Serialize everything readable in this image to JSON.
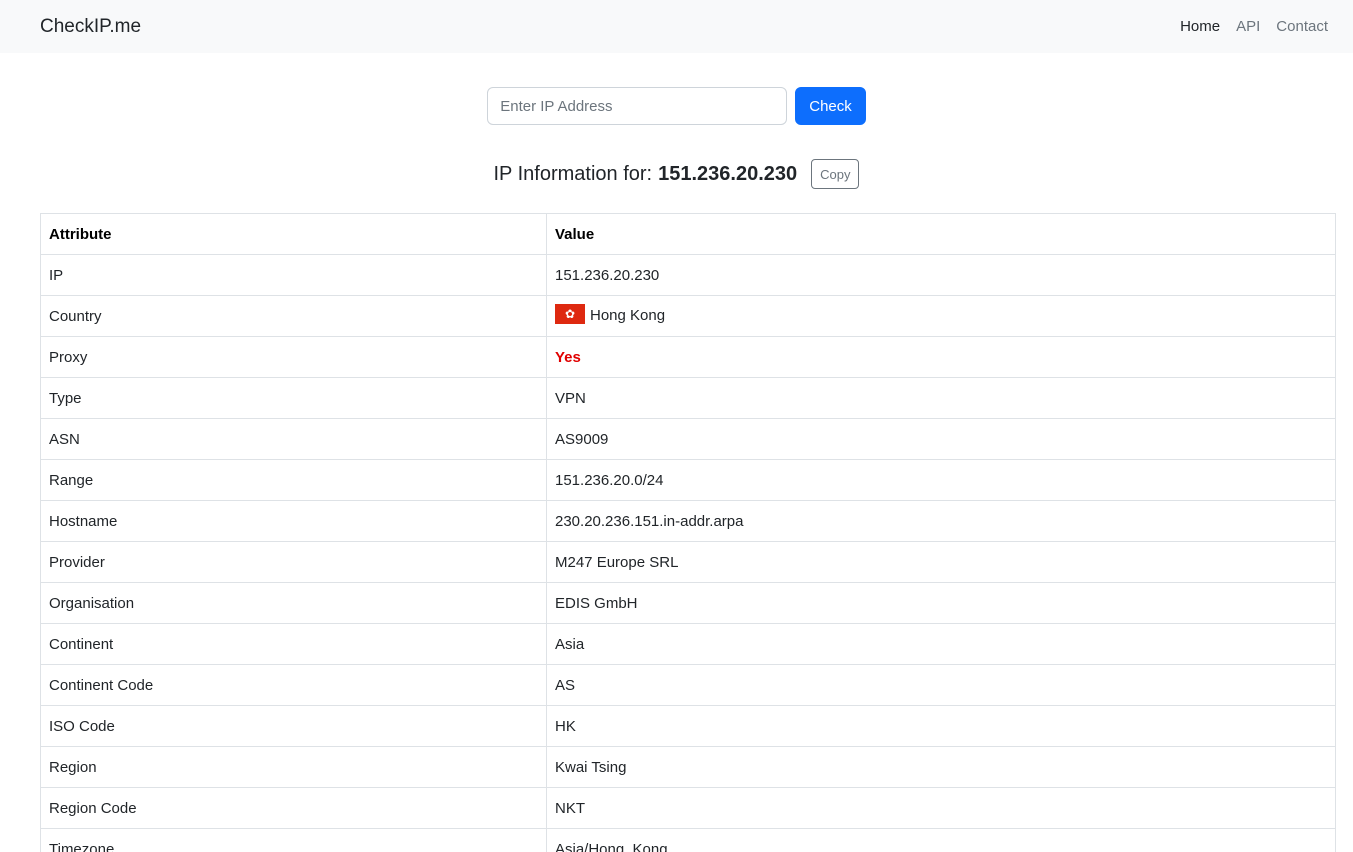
{
  "navbar": {
    "brand": "CheckIP.me",
    "links": [
      "Home",
      "API",
      "Contact"
    ]
  },
  "search": {
    "placeholder": "Enter IP Address",
    "value": "",
    "button_label": "Check"
  },
  "heading": {
    "prefix": "IP Information for:",
    "ip": "151.236.20.230",
    "copy_label": "Copy"
  },
  "table": {
    "headers": [
      "Attribute",
      "Value"
    ],
    "rows": [
      {
        "attribute": "IP",
        "value": "151.236.20.230"
      },
      {
        "attribute": "Country",
        "value": "Hong Kong"
      },
      {
        "attribute": "Proxy",
        "value": "Yes"
      },
      {
        "attribute": "Type",
        "value": "VPN"
      },
      {
        "attribute": "ASN",
        "value": "AS9009"
      },
      {
        "attribute": "Range",
        "value": "151.236.20.0/24"
      },
      {
        "attribute": "Hostname",
        "value": "230.20.236.151.in-addr.arpa"
      },
      {
        "attribute": "Provider",
        "value": "M247 Europe SRL"
      },
      {
        "attribute": "Organisation",
        "value": "EDIS GmbH"
      },
      {
        "attribute": "Continent",
        "value": "Asia"
      },
      {
        "attribute": "Continent Code",
        "value": "AS"
      },
      {
        "attribute": "ISO Code",
        "value": "HK"
      },
      {
        "attribute": "Region",
        "value": "Kwai Tsing"
      },
      {
        "attribute": "Region Code",
        "value": "NKT"
      },
      {
        "attribute": "Timezone",
        "value": "Asia/Hong_Kong"
      }
    ]
  },
  "colors": {
    "primary": "#0d6efd",
    "proxy_yes": "#e00000",
    "navbar_bg": "#f8f9fa",
    "flag_red": "#de2910"
  },
  "icons": {
    "country_flag": "hong-kong-flag-icon"
  }
}
